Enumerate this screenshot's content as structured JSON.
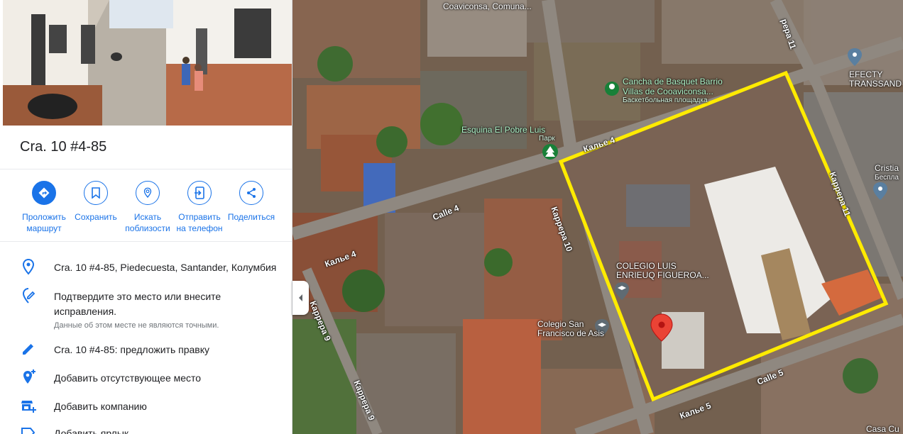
{
  "place": {
    "title": "Cra. 10 #4-85"
  },
  "actions": [
    {
      "label_1": "Проложить",
      "label_2": "маршрут",
      "icon": "directions-icon"
    },
    {
      "label_1": "Сохранить",
      "label_2": "",
      "icon": "bookmark-icon"
    },
    {
      "label_1": "Искать",
      "label_2": "поблизости",
      "icon": "nearby-icon"
    },
    {
      "label_1": "Отправить",
      "label_2": "на телефон",
      "icon": "send-to-phone-icon"
    },
    {
      "label_1": "Поделиться",
      "label_2": "",
      "icon": "share-icon"
    }
  ],
  "details": {
    "address": "Cra. 10 #4-85, Piedecuesta, Santander, Колумбия",
    "confirm_line1": "Подтвердите это место или внесите",
    "confirm_line2": "исправления.",
    "confirm_note": "Данные об этом месте не являются точными.",
    "suggest_edit": "Cra. 10 #4-85: предложить правку",
    "add_missing_place": "Добавить отсутствующее место",
    "add_business": "Добавить компанию",
    "add_label": "Добавить ярлык"
  },
  "map": {
    "labels": {
      "coaviconsa": "Coaviconsa, Comuna...",
      "cancha_line1": "Cancha de Basquet Barrio",
      "cancha_line2": "Villas de Cooaviconsa...",
      "cancha_sub": "Баскетбольная площадка",
      "esquina": "Esquina El Pobre Luis",
      "esquina_sub": "Парк",
      "efecty_line1": "EFECTY",
      "efecty_line2": "TRANSSAND",
      "cristia_line1": "Cristia",
      "cristia_line2": "Беспла",
      "colegio_luis_line1": "COLEGIO LUIS",
      "colegio_luis_line2": "ENRIEUQ FIGUEROA...",
      "colegio_san_line1": "Colegio San",
      "colegio_san_line2": "Francisco de Asis",
      "casa": "Casa Cu"
    },
    "streets": {
      "karrera11_top": "рера 11",
      "kalle4_top": "Калье 4",
      "calle4": "Calle 4",
      "kalbe4": "Калье 4",
      "karrera10": "Каррера 10",
      "karrera11": "Каррера 11",
      "karrera9_a": "Каррера 9",
      "karrera9_b": "Каррера 9",
      "calle5": "Calle 5",
      "kalbe5": "Калье 5"
    },
    "highlight_color": "#ffeb00",
    "pin_color": "#ea4335"
  }
}
